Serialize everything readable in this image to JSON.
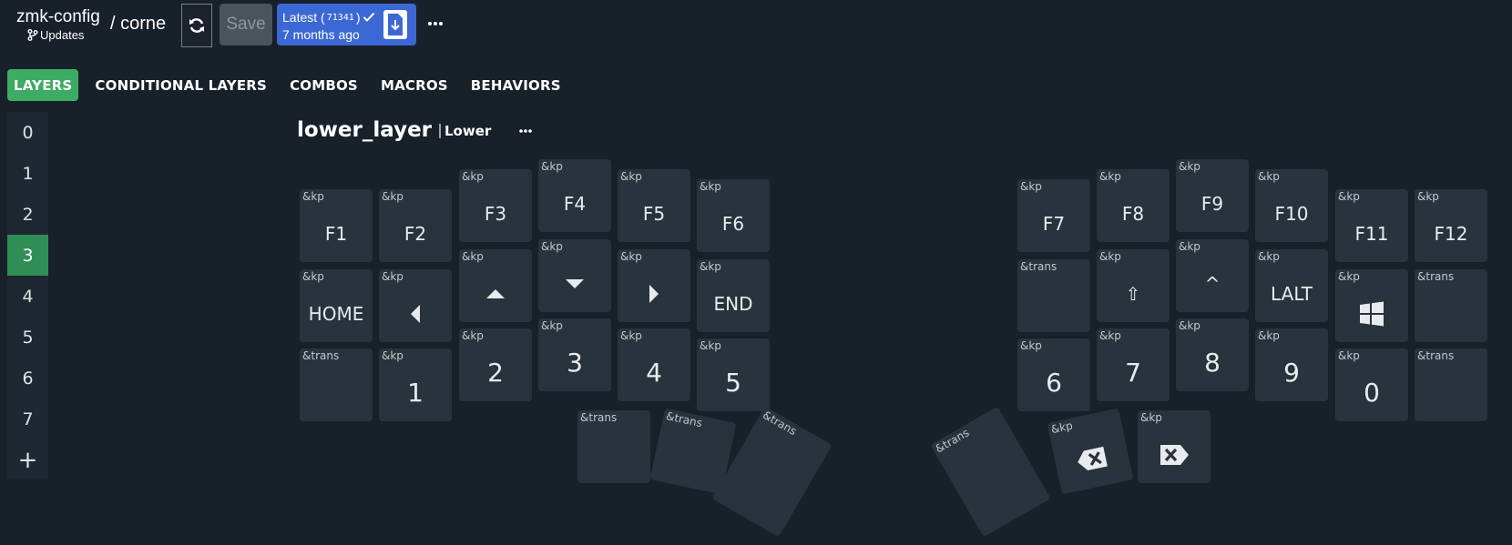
{
  "header": {
    "repo": "zmk-config",
    "updates_label": "Updates",
    "keyboard": "/ corne",
    "save_label": "Save",
    "latest_prefix": "Latest (",
    "latest_sha": "71341",
    "latest_suffix": ")",
    "latest_time": "7 months ago",
    "accent_color": "#3b68d4"
  },
  "tabs": [
    {
      "label": "LAYERS",
      "active": true
    },
    {
      "label": "CONDITIONAL LAYERS"
    },
    {
      "label": "COMBOS"
    },
    {
      "label": "MACROS"
    },
    {
      "label": "BEHAVIORS"
    }
  ],
  "layers": {
    "items": [
      "0",
      "1",
      "2",
      "3",
      "4",
      "5",
      "6",
      "7"
    ],
    "active_index": 3,
    "add_label": "+"
  },
  "layer": {
    "name": "lower_layer",
    "label": "Lower"
  },
  "keys": [
    {
      "behavior": "&kp",
      "param": "F1",
      "type": "fkey"
    },
    {
      "behavior": "&kp",
      "param": "F2",
      "type": "fkey"
    },
    {
      "behavior": "&kp",
      "param": "F3",
      "type": "fkey"
    },
    {
      "behavior": "&kp",
      "param": "F4",
      "type": "fkey"
    },
    {
      "behavior": "&kp",
      "param": "F5",
      "type": "fkey"
    },
    {
      "behavior": "&kp",
      "param": "F6",
      "type": "fkey"
    },
    {
      "behavior": "&kp",
      "param": "F7",
      "type": "fkey"
    },
    {
      "behavior": "&kp",
      "param": "F8",
      "type": "fkey"
    },
    {
      "behavior": "&kp",
      "param": "F9",
      "type": "fkey"
    },
    {
      "behavior": "&kp",
      "param": "F10",
      "type": "fkey"
    },
    {
      "behavior": "&kp",
      "param": "F11",
      "type": "fkey"
    },
    {
      "behavior": "&kp",
      "param": "F12",
      "type": "fkey"
    },
    {
      "behavior": "&kp",
      "param": "HOME",
      "type": "word"
    },
    {
      "behavior": "&kp",
      "param": "",
      "type": "icon",
      "icon": "arrow-left-icon"
    },
    {
      "behavior": "&kp",
      "param": "",
      "type": "icon",
      "icon": "arrow-up-icon"
    },
    {
      "behavior": "&kp",
      "param": "",
      "type": "icon",
      "icon": "arrow-down-icon"
    },
    {
      "behavior": "&kp",
      "param": "",
      "type": "icon",
      "icon": "arrow-right-icon"
    },
    {
      "behavior": "&kp",
      "param": "END",
      "type": "word"
    },
    {
      "behavior": "&trans",
      "param": "",
      "type": "none"
    },
    {
      "behavior": "&kp",
      "param": "⇧",
      "type": "word"
    },
    {
      "behavior": "&kp",
      "param": "^",
      "type": "word"
    },
    {
      "behavior": "&kp",
      "param": "LALT",
      "type": "word"
    },
    {
      "behavior": "&kp",
      "param": "",
      "type": "icon",
      "icon": "windows-icon"
    },
    {
      "behavior": "&trans",
      "param": "",
      "type": "none"
    },
    {
      "behavior": "&trans",
      "param": "",
      "type": "none"
    },
    {
      "behavior": "&kp",
      "param": "1",
      "type": "num"
    },
    {
      "behavior": "&kp",
      "param": "2",
      "type": "num"
    },
    {
      "behavior": "&kp",
      "param": "3",
      "type": "num"
    },
    {
      "behavior": "&kp",
      "param": "4",
      "type": "num"
    },
    {
      "behavior": "&kp",
      "param": "5",
      "type": "num"
    },
    {
      "behavior": "&kp",
      "param": "6",
      "type": "num"
    },
    {
      "behavior": "&kp",
      "param": "7",
      "type": "num"
    },
    {
      "behavior": "&kp",
      "param": "8",
      "type": "num"
    },
    {
      "behavior": "&kp",
      "param": "9",
      "type": "num"
    },
    {
      "behavior": "&kp",
      "param": "0",
      "type": "num"
    },
    {
      "behavior": "&trans",
      "param": "",
      "type": "none"
    },
    {
      "behavior": "&trans",
      "param": "",
      "type": "none"
    },
    {
      "behavior": "&trans",
      "param": "",
      "type": "none"
    },
    {
      "behavior": "&trans",
      "param": "",
      "type": "none"
    },
    {
      "behavior": "&trans",
      "param": "",
      "type": "none"
    },
    {
      "behavior": "&kp",
      "param": "",
      "type": "icon",
      "icon": "backspace-icon"
    },
    {
      "behavior": "&kp",
      "param": "",
      "type": "icon",
      "icon": "delete-icon"
    }
  ]
}
